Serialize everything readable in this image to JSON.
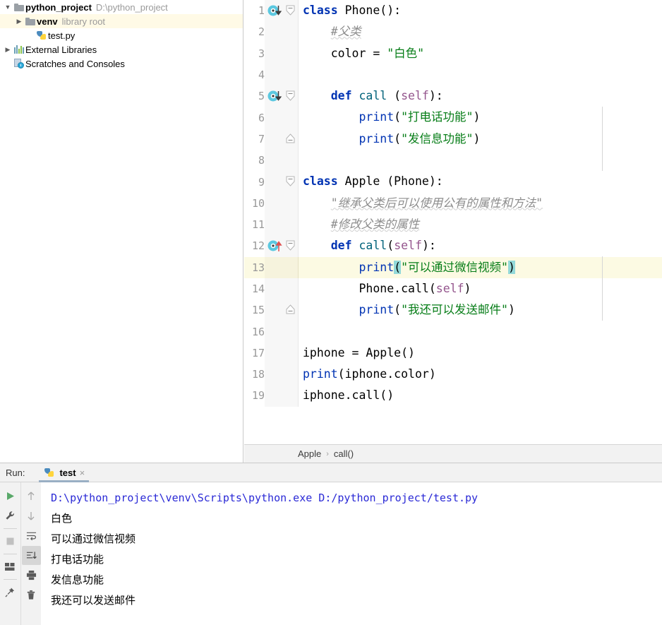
{
  "project": {
    "tree": [
      {
        "arrow": "v",
        "icon": "folder-icon",
        "label": "python_project",
        "sub": "D:\\python_project",
        "bold": true,
        "indent": 0,
        "selected": false
      },
      {
        "arrow": ">",
        "icon": "folder-icon",
        "label": "venv",
        "sub": "library root",
        "bold": true,
        "indent": 1,
        "selected": true
      },
      {
        "arrow": "",
        "icon": "python-file-icon",
        "label": "test.py",
        "sub": "",
        "bold": false,
        "indent": 2,
        "selected": false
      },
      {
        "arrow": ">",
        "icon": "external-libraries-icon",
        "label": "External Libraries",
        "sub": "",
        "bold": false,
        "indent": 0,
        "selected": false
      },
      {
        "arrow": "",
        "icon": "scratches-icon",
        "label": "Scratches and Consoles",
        "sub": "",
        "bold": false,
        "indent": 0,
        "selected": false
      }
    ]
  },
  "editor": {
    "lines": [
      {
        "n": "1",
        "runmark": "run-down",
        "fold": "start",
        "current": false
      },
      {
        "n": "2",
        "runmark": "",
        "fold": "",
        "current": false
      },
      {
        "n": "3",
        "runmark": "",
        "fold": "",
        "current": false
      },
      {
        "n": "4",
        "runmark": "",
        "fold": "",
        "current": false
      },
      {
        "n": "5",
        "runmark": "run-down",
        "fold": "start",
        "current": false
      },
      {
        "n": "6",
        "runmark": "",
        "fold": "",
        "current": false
      },
      {
        "n": "7",
        "runmark": "",
        "fold": "end",
        "current": false
      },
      {
        "n": "8",
        "runmark": "",
        "fold": "",
        "current": false
      },
      {
        "n": "9",
        "runmark": "",
        "fold": "start",
        "current": false
      },
      {
        "n": "10",
        "runmark": "",
        "fold": "",
        "current": false
      },
      {
        "n": "11",
        "runmark": "",
        "fold": "",
        "current": false
      },
      {
        "n": "12",
        "runmark": "override-up",
        "fold": "start",
        "current": false
      },
      {
        "n": "13",
        "runmark": "",
        "fold": "",
        "current": true
      },
      {
        "n": "14",
        "runmark": "",
        "fold": "",
        "current": false
      },
      {
        "n": "15",
        "runmark": "",
        "fold": "end",
        "current": false
      },
      {
        "n": "16",
        "runmark": "",
        "fold": "",
        "current": false
      },
      {
        "n": "17",
        "runmark": "",
        "fold": "",
        "current": false
      },
      {
        "n": "18",
        "runmark": "",
        "fold": "",
        "current": false
      },
      {
        "n": "19",
        "runmark": "",
        "fold": "",
        "current": false
      }
    ],
    "source": [
      "class Phone():",
      "    #父类",
      "    color = \"白色\"",
      "",
      "    def call (self):",
      "        print(\"打电话功能\")",
      "        print(\"发信息功能\")",
      "",
      "class Apple (Phone):",
      "    \"继承父类后可以使用公有的属性和方法\"",
      "    #修改父类的属性",
      "    def call(self):",
      "        print(\"可以通过微信视频\")",
      "        Phone.call(self)",
      "        print(\"我还可以发送邮件\")",
      "",
      "iphone = Apple()",
      "print(iphone.color)",
      "iphone.call()"
    ],
    "breadcrumb": {
      "class": "Apple",
      "separator": "›",
      "method": "call()"
    }
  },
  "run_panel": {
    "label": "Run:",
    "tab": {
      "name": "test",
      "icon": "python-file-icon",
      "close": "×"
    },
    "toolbar_left": [
      {
        "name": "rerun-button",
        "icon": "play-icon"
      },
      {
        "name": "settings-button",
        "icon": "wrench-icon"
      },
      {
        "name": "stop-button",
        "icon": "stop-square-icon"
      },
      {
        "name": "layout-button",
        "icon": "layout-icon"
      },
      {
        "name": "pin-tab-button",
        "icon": "pin-icon"
      }
    ],
    "toolbar_right": [
      {
        "name": "up-stacktrace-button",
        "icon": "arrow-up-icon",
        "active": false
      },
      {
        "name": "down-stacktrace-button",
        "icon": "arrow-down-icon",
        "active": false
      },
      {
        "name": "soft-wrap-button",
        "icon": "soft-wrap-icon",
        "active": false
      },
      {
        "name": "scroll-to-end-button",
        "icon": "scroll-end-icon",
        "active": true
      },
      {
        "name": "print-button",
        "icon": "printer-icon",
        "active": false
      },
      {
        "name": "clear-all-button",
        "icon": "trash-icon",
        "active": false
      }
    ],
    "console": [
      {
        "text": "D:\\python_project\\venv\\Scripts\\python.exe D:/python_project/test.py",
        "kind": "cmd"
      },
      {
        "text": "白色",
        "kind": "out"
      },
      {
        "text": "可以通过微信视频",
        "kind": "out"
      },
      {
        "text": "打电话功能",
        "kind": "out"
      },
      {
        "text": "发信息功能",
        "kind": "out"
      },
      {
        "text": "我还可以发送邮件",
        "kind": "out"
      }
    ]
  },
  "colors": {
    "keyword": "#0033b3",
    "string": "#067d17",
    "comment": "#8c8c8c",
    "self_param": "#94558d",
    "function": "#00627a",
    "current_line": "#fcfae3",
    "paren_match": "#93d9d9",
    "selection_row": "#fffae6",
    "console_command": "#2a29d6"
  }
}
